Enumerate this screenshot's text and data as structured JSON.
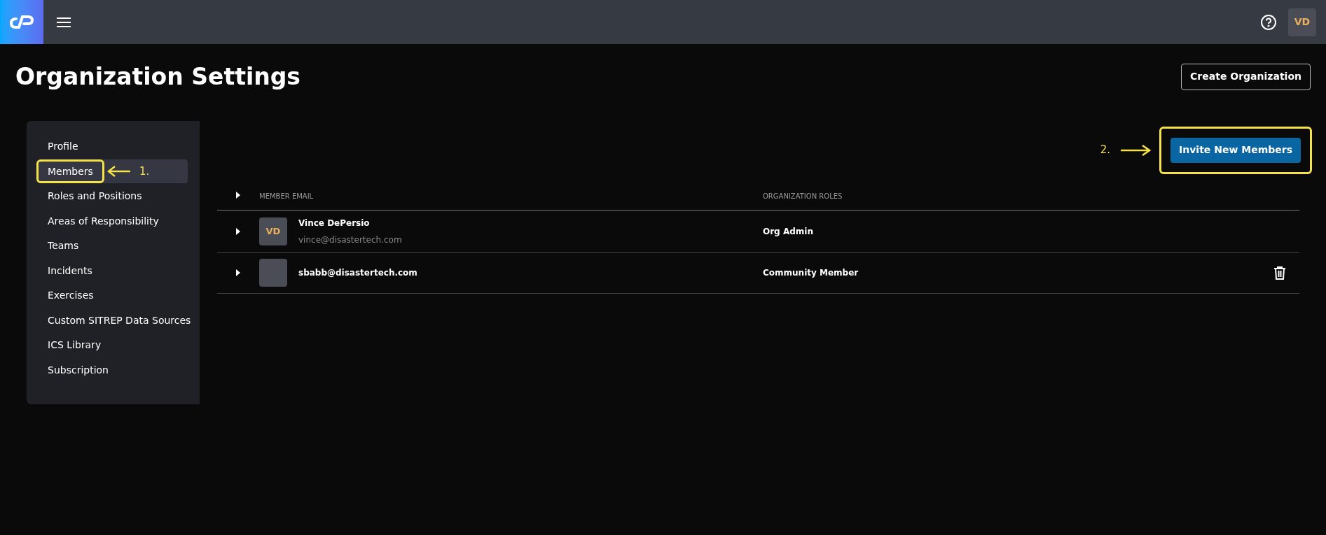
{
  "header": {
    "user_initials": "VD"
  },
  "page": {
    "title": "Organization Settings",
    "create_button": "Create Organization"
  },
  "sidebar": {
    "items": [
      {
        "label": "Profile",
        "selected": false
      },
      {
        "label": "Members",
        "selected": true,
        "callout": "1."
      },
      {
        "label": "Roles and Positions",
        "selected": false
      },
      {
        "label": "Areas of Responsibility",
        "selected": false
      },
      {
        "label": "Teams",
        "selected": false
      },
      {
        "label": "Incidents",
        "selected": false
      },
      {
        "label": "Exercises",
        "selected": false
      },
      {
        "label": "Custom SITREP Data Sources",
        "selected": false
      },
      {
        "label": "ICS Library",
        "selected": false
      },
      {
        "label": "Subscription",
        "selected": false
      }
    ]
  },
  "invite_button": {
    "label": "Invite New Members",
    "callout": "2."
  },
  "table": {
    "columns": [
      "MEMBER EMAIL",
      "ORGANIZATION ROLES"
    ],
    "rows": [
      {
        "initials": "VD",
        "name": "Vince DePersio",
        "email": "vince@disastertech.com",
        "role": "Org Admin",
        "deletable": false
      },
      {
        "email": "sbabb@disastertech.com",
        "role": "Community Member",
        "deletable": true
      }
    ]
  }
}
